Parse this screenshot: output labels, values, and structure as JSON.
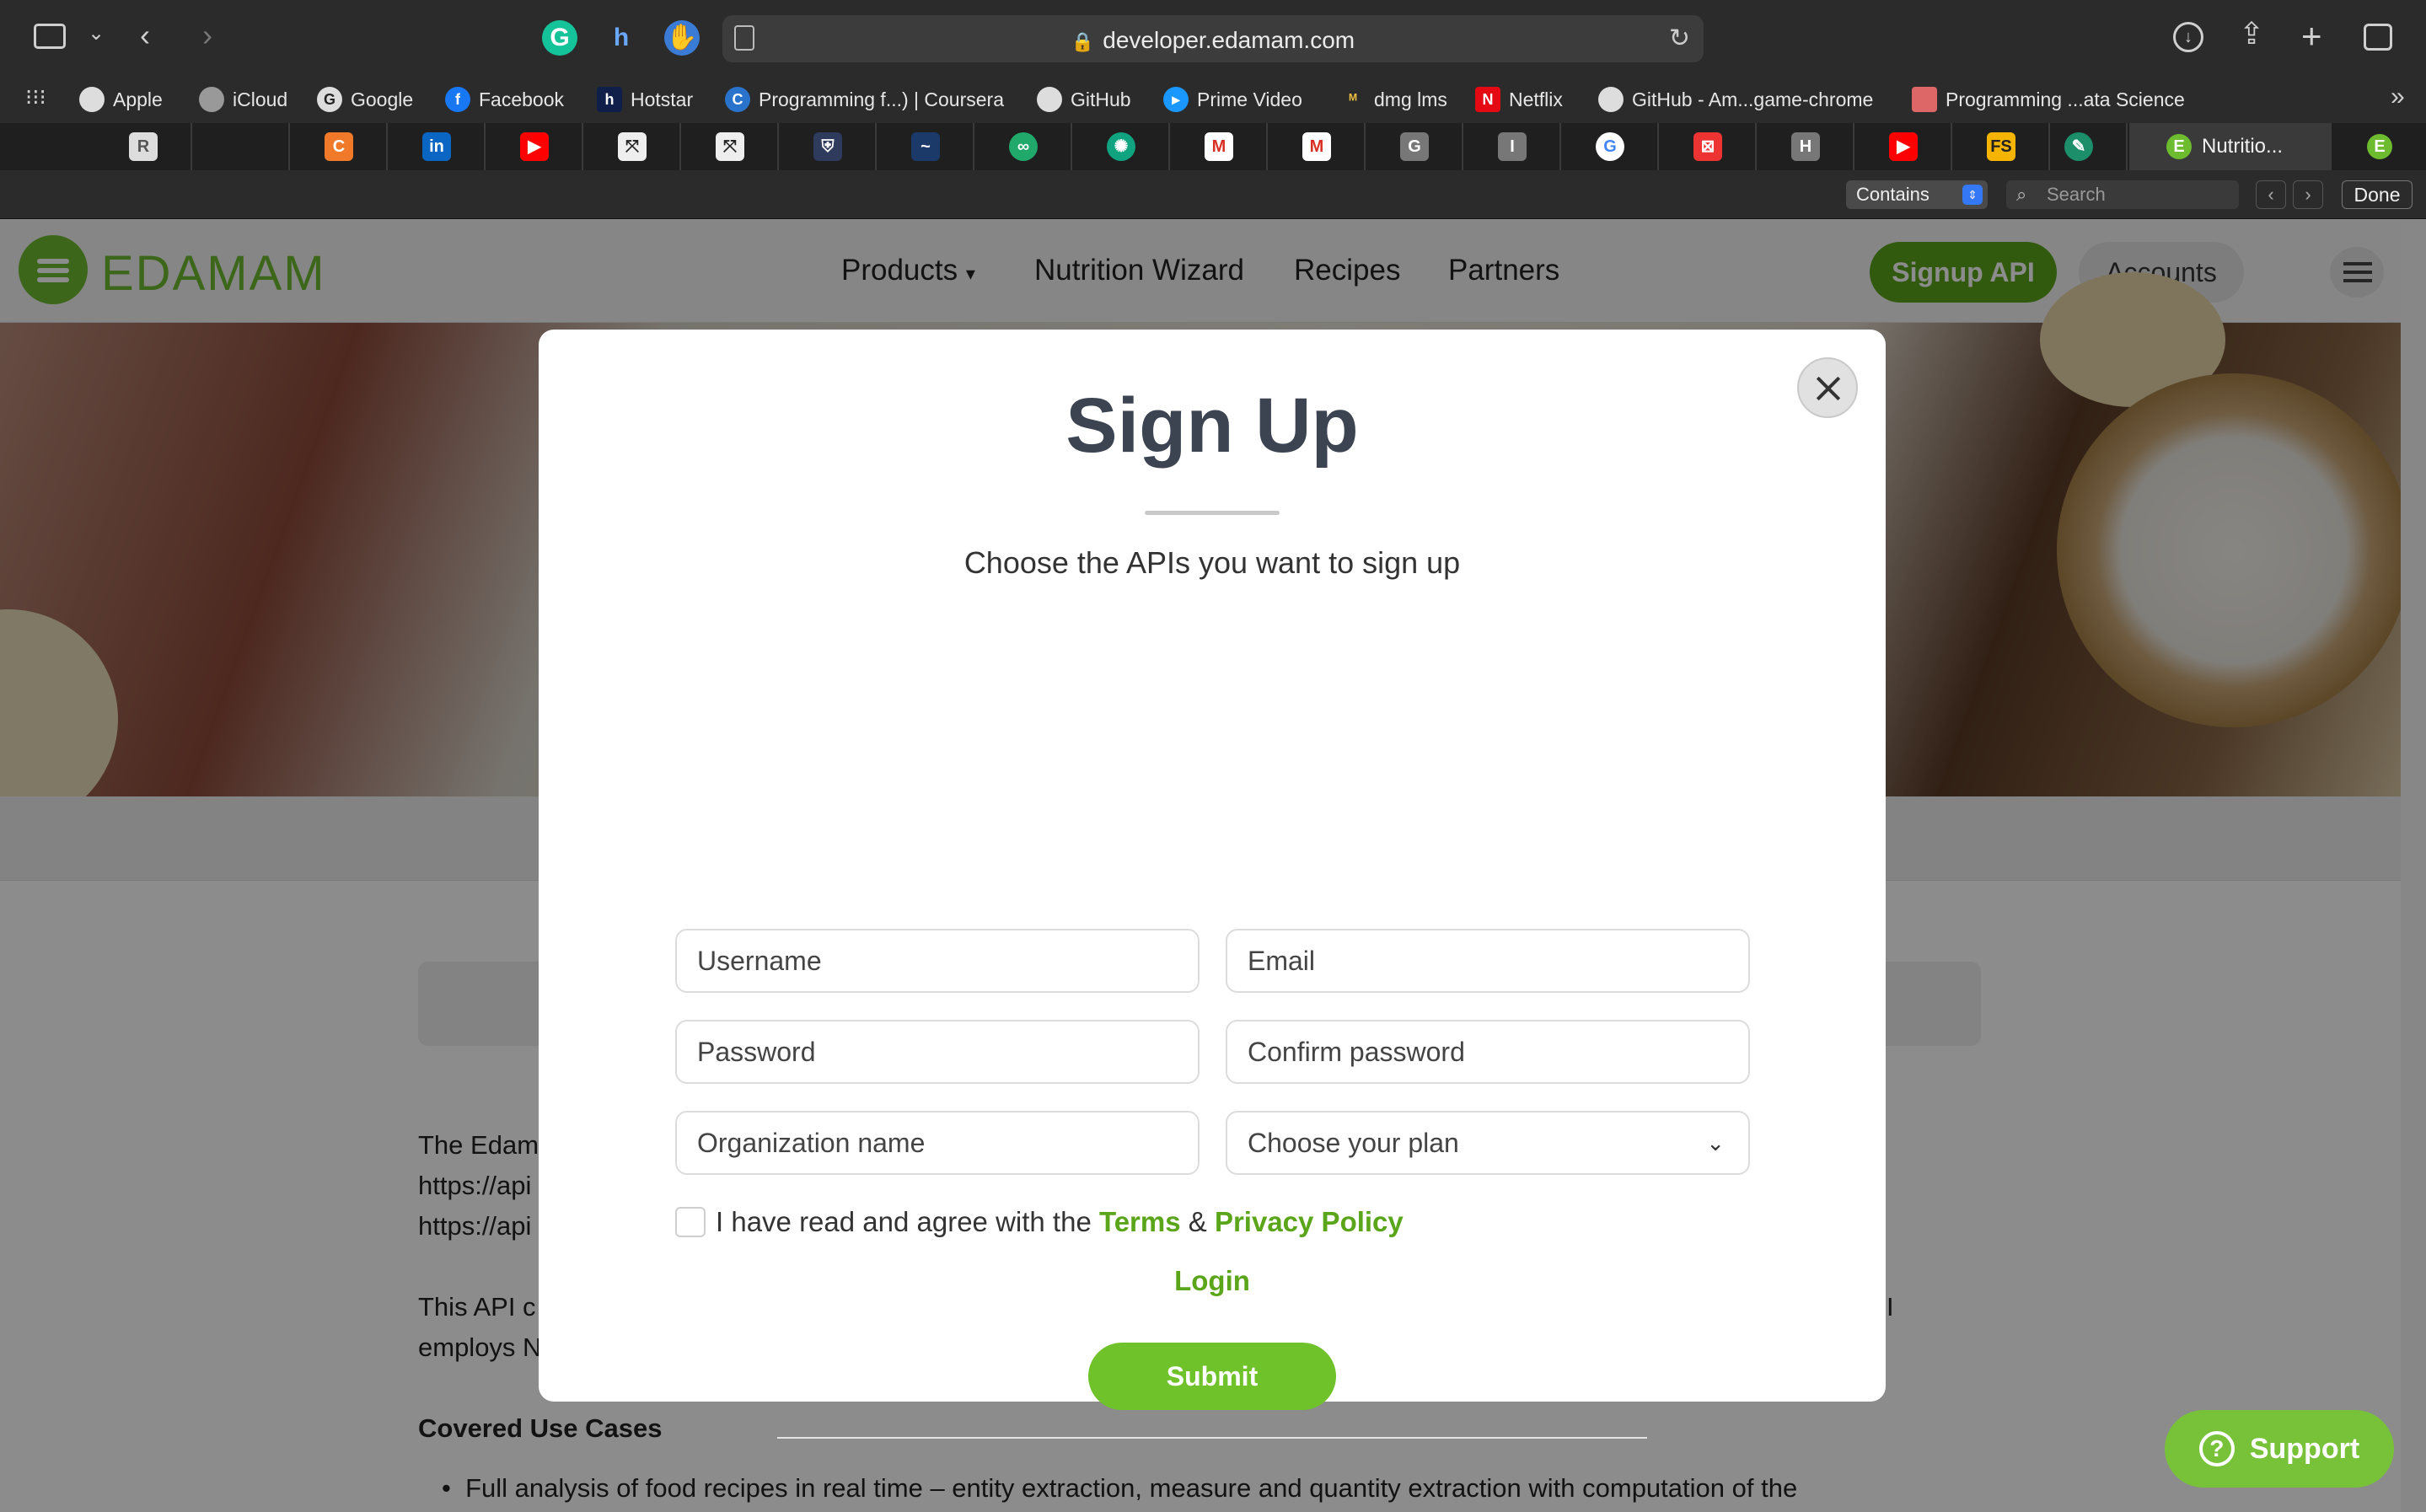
{
  "browser": {
    "url": "developer.edamam.com",
    "bookmarks": [
      {
        "label": "Apple",
        "icon": "apple-icon"
      },
      {
        "label": "iCloud",
        "icon": "apple-icon"
      },
      {
        "label": "Google",
        "icon": "google-icon"
      },
      {
        "label": "Facebook",
        "icon": "facebook-icon"
      },
      {
        "label": "Hotstar",
        "icon": "hotstar-icon"
      },
      {
        "label": "Programming f...) | Coursera",
        "icon": "coursera-icon"
      },
      {
        "label": "GitHub",
        "icon": "github-icon"
      },
      {
        "label": "Prime Video",
        "icon": "prime-video-icon"
      },
      {
        "label": "dmg lms",
        "icon": "dmg-icon"
      },
      {
        "label": "Netflix",
        "icon": "netflix-icon"
      },
      {
        "label": "GitHub - Am...game-chrome",
        "icon": "github-icon"
      },
      {
        "label": "Programming ...ata Science",
        "icon": "bookmark-icon"
      }
    ],
    "active_tab_label": "Nutritio...",
    "find": {
      "mode": "Contains",
      "placeholder": "Search",
      "done_label": "Done"
    }
  },
  "site": {
    "logo_text": "EDAMAM",
    "nav": {
      "products": "Products",
      "nutrition_wizard": "Nutrition Wizard",
      "recipes": "Recipes",
      "partners": "Partners"
    },
    "signup_api": "Signup API",
    "accounts": "Accounts",
    "body": {
      "line1": "The Edam",
      "line2": "https://api",
      "line3": "https://api",
      "line4a": "This API c",
      "line4b": "I",
      "line5": "employs N",
      "heading": "Covered Use Cases",
      "bullet": "Full analysis of food recipes in real time – entity extraction, measure and quantity extraction with computation of the"
    },
    "support_label": "Support"
  },
  "modal": {
    "title": "Sign Up",
    "subtitle": "Choose the APIs you want to sign up",
    "fields": {
      "username": "Username",
      "email": "Email",
      "password": "Password",
      "confirm_password": "Confirm password",
      "organization": "Organization name"
    },
    "plan_select": "Choose your plan",
    "agree_prefix": "I have read and agree with the",
    "terms": "Terms",
    "amp": "&",
    "privacy": "Privacy Policy",
    "submit": "Submit",
    "login": "Login"
  },
  "colors": {
    "brand_green": "#6dbb2e",
    "button_green": "#6fc22a",
    "link_green": "#5aa51a",
    "title_color": "#3d4451"
  }
}
